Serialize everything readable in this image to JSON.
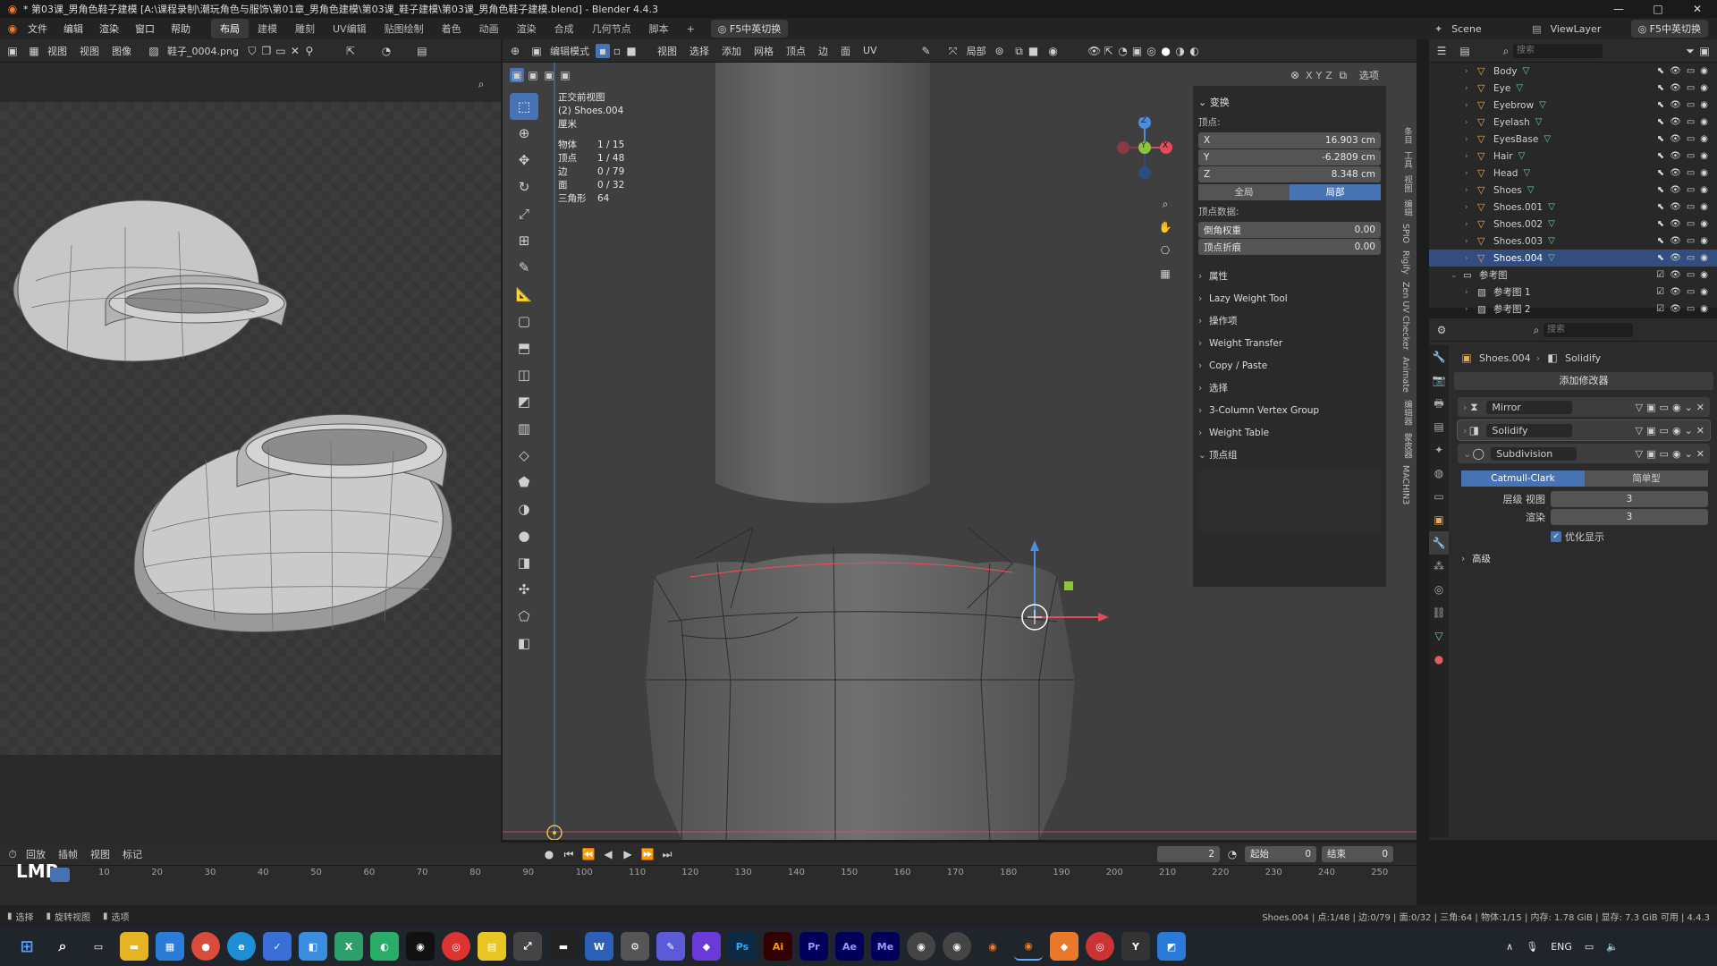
{
  "titlebar": {
    "title": "* 第03课_男角色鞋子建模 [A:\\课程录制\\潮玩角色与服饰\\第01章_男角色建模\\第03课_鞋子建模\\第03课_男角色鞋子建模.blend] - Blender 4.4.3"
  },
  "menu": {
    "items": [
      "文件",
      "编辑",
      "渲染",
      "窗口",
      "帮助"
    ],
    "workspaces": [
      "布局",
      "建模",
      "雕刻",
      "UV编辑",
      "贴图绘制",
      "着色",
      "动画",
      "渲染",
      "合成",
      "几何节点",
      "脚本"
    ],
    "active_workspace": "布局",
    "ime_label": "F5中英切换",
    "scene_label": "Scene",
    "viewlayer_label": "ViewLayer",
    "ime_label_right": "F5中英切换"
  },
  "image_editor": {
    "menus": [
      "视图",
      "视图",
      "图像"
    ],
    "image_name": "鞋子_0004.png"
  },
  "viewport": {
    "mode": "编辑模式",
    "menus": [
      "视图",
      "选择",
      "添加",
      "网格",
      "顶点",
      "边",
      "面",
      "UV"
    ],
    "transform_orient": "局部",
    "axes": [
      "X",
      "Y",
      "Z"
    ],
    "options_label": "选项",
    "overlay": {
      "view_name": "正交前视图",
      "object_name": "(2) Shoes.004",
      "units": "厘米",
      "stats": [
        {
          "label": "物体",
          "value": "1 / 15"
        },
        {
          "label": "顶点",
          "value": "1 / 48"
        },
        {
          "label": "边",
          "value": "0 / 79"
        },
        {
          "label": "面",
          "value": "0 / 32"
        },
        {
          "label": "三角形",
          "value": "64"
        }
      ]
    },
    "gizmo_labels": {
      "x": "X",
      "y": "Y",
      "z": "Z"
    }
  },
  "npanel": {
    "transform_title": "变换",
    "vertex_label": "顶点:",
    "x_label": "X",
    "x_value": "16.903 cm",
    "y_label": "Y",
    "y_value": "-6.2809 cm",
    "z_label": "Z",
    "z_value": "8.348 cm",
    "global_label": "全局",
    "local_label": "局部",
    "vertex_data_label": "顶点数据:",
    "bevel_weight_label": "倒角权重",
    "bevel_weight_value": "0.00",
    "vertex_crease_label": "顶点折痕",
    "vertex_crease_value": "0.00",
    "sections": [
      "属性",
      "Lazy Weight Tool",
      "操作项",
      "Weight Transfer",
      "Copy / Paste",
      "选择",
      "3-Column Vertex Group",
      "Weight Table",
      "顶点组"
    ],
    "side_tabs": [
      "条目",
      "工具",
      "视图",
      "编辑",
      "SPIO",
      "Rigify",
      "Zen UV Checker",
      "Animate",
      "编辑器",
      "蒙皮器",
      "MACHIN3"
    ]
  },
  "outliner": {
    "search_placeholder": "搜索",
    "rows": [
      {
        "name": "Body",
        "selected": false
      },
      {
        "name": "Eye",
        "selected": false
      },
      {
        "name": "Eyebrow",
        "selected": false
      },
      {
        "name": "Eyelash",
        "selected": false
      },
      {
        "name": "EyesBase",
        "selected": false
      },
      {
        "name": "Hair",
        "selected": false
      },
      {
        "name": "Head",
        "selected": false
      },
      {
        "name": "Shoes",
        "selected": false
      },
      {
        "name": "Shoes.001",
        "selected": false
      },
      {
        "name": "Shoes.002",
        "selected": false
      },
      {
        "name": "Shoes.003",
        "selected": false
      },
      {
        "name": "Shoes.004",
        "selected": true
      }
    ],
    "collection": "参考图",
    "ref_rows": [
      "参考图 1",
      "参考图 2"
    ]
  },
  "properties": {
    "search_placeholder": "搜索",
    "breadcrumb_object": "Shoes.004",
    "breadcrumb_mod": "Solidify",
    "add_modifier": "添加修改器",
    "modifiers": [
      "Mirror",
      "Solidify",
      "Subdivision"
    ],
    "subdiv": {
      "tab_active": "Catmull-Clark",
      "tab_other": "简单型",
      "levels_label": "层级 视图",
      "levels_value": "3",
      "render_label": "渲染",
      "render_value": "3",
      "optimal_label": "优化显示",
      "advanced_label": "高级"
    }
  },
  "timeline": {
    "menus": [
      "回放",
      "插帧",
      "视图",
      "标记"
    ],
    "current_frame": "2",
    "start_label": "起始",
    "start_value": "0",
    "end_label": "结束",
    "end_value": "0",
    "ticks": [
      "10",
      "20",
      "30",
      "40",
      "50",
      "60",
      "70",
      "80",
      "90",
      "100",
      "110",
      "120",
      "130",
      "140",
      "150",
      "160",
      "170",
      "180",
      "190",
      "200",
      "210",
      "220",
      "230",
      "240",
      "250"
    ],
    "lmb_label": "LMB"
  },
  "statusbar": {
    "left": [
      "选择",
      "旋转视图",
      "选项"
    ],
    "right": "Shoes.004 | 点:1/48 | 边:0/79 | 面:0/32 | 三角:64 | 物体:1/15 | 内存: 1.78 GiB | 显存: 7.3 GiB 可用 | 4.4.3"
  },
  "taskbar": {
    "lang": "ENG",
    "apps": [
      "Ps",
      "Ai",
      "Pr",
      "Ae",
      "Me"
    ]
  },
  "colors": {
    "accent": "#4772b3",
    "selected_row": "#334d80",
    "x_axis": "#e04c5a",
    "y_axis": "#8cc43c",
    "z_axis": "#4a8ee0"
  }
}
